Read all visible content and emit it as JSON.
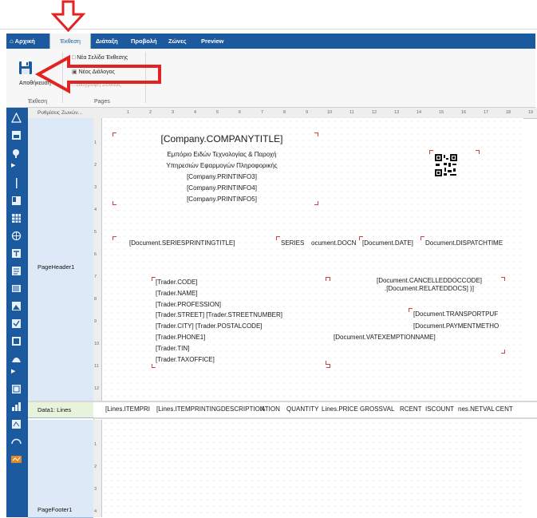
{
  "menubar": {
    "tabs": [
      {
        "label": "Αρχική",
        "icon": "home-icon"
      },
      {
        "label": "Έκθεση",
        "active": true
      },
      {
        "label": "Διάταξη"
      },
      {
        "label": "Προβολή"
      },
      {
        "label": "Ζώνες"
      },
      {
        "label": "Preview"
      }
    ]
  },
  "ribbon": {
    "save_label": "Αποθήκευση",
    "group1_label": "Έκθεση",
    "pages_items": [
      {
        "label": "Νέα Σελίδα Έκθεσης",
        "icon": "new-page-icon"
      },
      {
        "label": "Νέος Διάλογος",
        "icon": "new-dialog-icon"
      },
      {
        "label": "Διαγραφή Σελίδας",
        "icon": "delete-page-icon"
      }
    ],
    "group2_label": "Pages"
  },
  "bands": {
    "header_title": "Ρυθμίσεις Ζωνών...",
    "page_header": "PageHeader1",
    "data": "Data1: Lines",
    "page_footer": "PageFooter1"
  },
  "ruler": {
    "top": [
      "1",
      "2",
      "3",
      "4",
      "5",
      "6",
      "7",
      "8",
      "9",
      "10",
      "11",
      "12",
      "13",
      "14",
      "15",
      "16",
      "17",
      "18",
      "19"
    ],
    "header_side": [
      "1",
      "2",
      "3",
      "4",
      "5",
      "6",
      "7",
      "8",
      "9",
      "10",
      "11",
      "12"
    ],
    "footer_side": [
      "1",
      "2",
      "3",
      "4"
    ]
  },
  "page_header": {
    "company_title": "[Company.COMPANYTITLE]",
    "company_desc_1": "Εμπόριο Ειδών Τεχνολογίας & Παροχή",
    "company_desc_2": "Υπηρεσιών Εφαρμογών Πληροφορικής",
    "printinfo3": "[Company.PRINTINFO3]",
    "printinfo4": "[Company.PRINTINFO4]",
    "printinfo5": "[Company.PRINTINFO5]",
    "series_title": "[Document.SERIESPRINTINGTITLE]",
    "series_field": "SERIES",
    "docno_field": "ocument.DOCN",
    "date_field": "[Document.DATE]",
    "dispatch_field": "Document.DISPATCHTIME",
    "trader_fields": [
      "[Trader.CODE]",
      "[Trader.NAME]",
      "[Trader.PROFESSION]",
      "[Trader.STREET] [Trader.STREETNUMBER]",
      "[Trader.CITY] [Trader.POSTALCODE]",
      "[Trader.PHONE1]",
      "[Trader.TIN]",
      "[Trader.TAXOFFICE]"
    ],
    "cancelled_doc": "[Document.CANCELLEDDOCCODE]",
    "related_docs": ".[Document.RELATEDDOCS] )]",
    "transport": "[Document.TRANSPORTPUF",
    "payment": "[Document.PAYMENTMETHO",
    "vat_exemption": "[Document.VATEXEMPTIONNAME]"
  },
  "data_line": {
    "fields": [
      "[Lines.ITEMPRI",
      "[Lines.ITEMPRINTINGDESCRIPTION",
      "ATION",
      "QUANTITY",
      "Lines.PRICE",
      "GROSSVAL",
      "RCENT",
      "ISCOUNT",
      "nes.NETVAL",
      "CENT"
    ]
  },
  "colors": {
    "accent": "#1c5aa0",
    "annotation_red": "#e32222"
  }
}
